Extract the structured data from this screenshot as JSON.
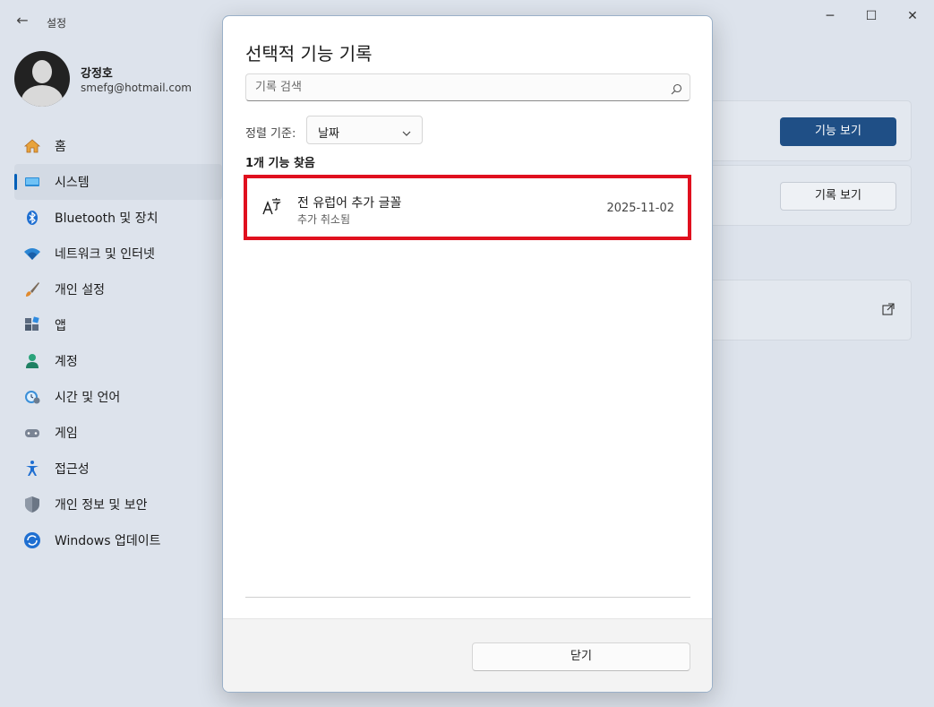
{
  "window": {
    "app_title": "설정",
    "back_icon": "←",
    "minimize_icon": "─",
    "maximize_icon": "☐",
    "close_icon": "✕"
  },
  "profile": {
    "name": "강정호",
    "email": "smefg@hotmail.com"
  },
  "sidebar": {
    "items": [
      {
        "label": "홈",
        "icon": "home-icon"
      },
      {
        "label": "시스템",
        "icon": "system-icon",
        "active": true
      },
      {
        "label": "Bluetooth 및 장치",
        "icon": "bluetooth-icon"
      },
      {
        "label": "네트워크 및 인터넷",
        "icon": "wifi-icon"
      },
      {
        "label": "개인 설정",
        "icon": "brush-icon"
      },
      {
        "label": "앱",
        "icon": "apps-icon"
      },
      {
        "label": "계정",
        "icon": "account-icon"
      },
      {
        "label": "시간 및 언어",
        "icon": "time-language-icon"
      },
      {
        "label": "게임",
        "icon": "gamepad-icon"
      },
      {
        "label": "접근성",
        "icon": "accessibility-icon"
      },
      {
        "label": "개인 정보 및 보안",
        "icon": "shield-icon"
      },
      {
        "label": "Windows 업데이트",
        "icon": "update-icon"
      }
    ]
  },
  "background": {
    "view_features_label": "기능 보기",
    "view_history_label": "기록 보기",
    "accent_color": "#1f4f86"
  },
  "dialog": {
    "title": "선택적 기능 기록",
    "search_placeholder": "기록 검색",
    "sort_label": "정렬 기준:",
    "sort_value": "날짜",
    "result_count": "1개 기능 찾음",
    "features": [
      {
        "name": "전 유럽어 추가 글꼴",
        "status": "추가 취소됨",
        "date": "2025-11-02",
        "icon": "font-language-icon"
      }
    ],
    "close_label": "닫기",
    "highlight_color": "#e0101e"
  }
}
